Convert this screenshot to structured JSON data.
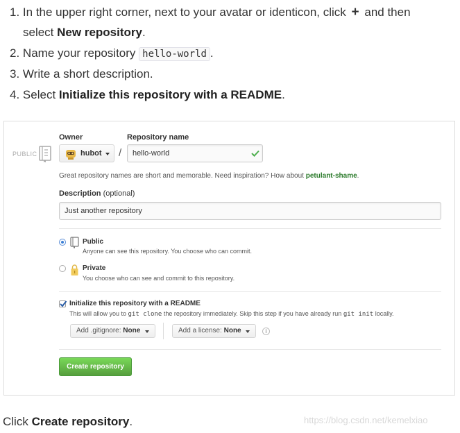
{
  "steps": [
    {
      "num": "1.",
      "text_a": "In the upper right corner, next to your avatar or identicon, click",
      "plus": "+",
      "text_b": "and then",
      "text_c": "select",
      "bold": "New repository",
      "tail": "."
    },
    {
      "num": "2.",
      "text_a": "Name your repository",
      "code": "hello-world",
      "tail": "."
    },
    {
      "num": "3.",
      "text_a": "Write a short description."
    },
    {
      "num": "4.",
      "text_a": "Select",
      "bold": "Initialize this repository with a README",
      "tail": "."
    }
  ],
  "form": {
    "visibility_side_label": "PUBLIC",
    "owner_label": "Owner",
    "owner_value": "hubot",
    "slash": "/",
    "repo_name_label": "Repository name",
    "repo_name_value": "hello-world",
    "name_hint": "Great repository names are short and memorable. Need inspiration? How about",
    "name_suggestion": "petulant-shame",
    "name_hint_tail": ".",
    "description_label": "Description",
    "description_optional": "(optional)",
    "description_value": "Just another repository",
    "public_title": "Public",
    "public_desc": "Anyone can see this repository. You choose who can commit.",
    "private_title": "Private",
    "private_desc": "You choose who can see and commit to this repository.",
    "init_title": "Initialize this repository with a README",
    "init_desc_a": "This will allow you to",
    "init_desc_code_a": "git clone",
    "init_desc_b": "the repository immediately. Skip this step if you have already run",
    "init_desc_code_b": "git init",
    "init_desc_c": "locally.",
    "gitignore_label": "Add .gitignore:",
    "gitignore_value": "None",
    "license_label": "Add a license:",
    "license_value": "None",
    "info_glyph": "i",
    "create_button": "Create repository",
    "selected_visibility": "Public",
    "init_checked": true
  },
  "footer": {
    "text_a": "Click",
    "bold": "Create repository",
    "tail": "."
  },
  "watermark": "https://blog.csdn.net/kemelxiao",
  "colors": {
    "accent_green": "#569e3d",
    "check_green": "#4cae4c",
    "radio_blue": "#3b7fd6",
    "suggestion_green": "#2a7a2a"
  }
}
